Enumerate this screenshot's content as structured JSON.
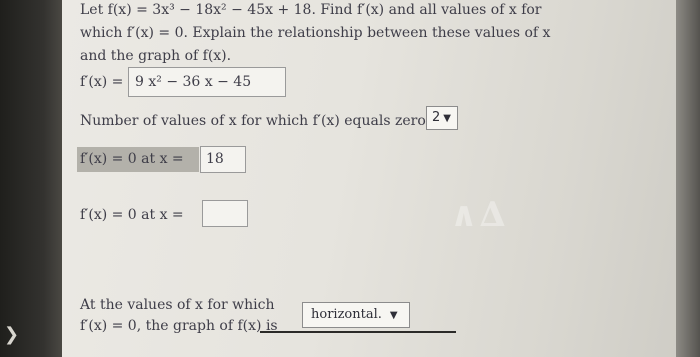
{
  "problem": {
    "line1": "Let f(x) = 3x³ − 18x² − 45x + 18. Find f′(x) and all values of x for",
    "line2": "which f′(x) = 0. Explain the relationship between these values of x",
    "line3": "and the graph of f(x)."
  },
  "derivative": {
    "label": "f′(x) =",
    "value": "9 x² − 36 x − 45"
  },
  "count": {
    "prompt": "Number of values of x for which f′(x) equals zero:",
    "selected": "2"
  },
  "zero1": {
    "label": "f′(x) = 0 at x =",
    "value": "18"
  },
  "zero2": {
    "label": "f′(x) = 0 at x =",
    "value": ""
  },
  "conclusion": {
    "line1": "At the values of x for which",
    "line2": "f′(x) = 0, the graph of f(x) is",
    "selected": "horizontal."
  },
  "icons": {
    "dropdown": "triangle-down",
    "corner": "arrow-right"
  }
}
